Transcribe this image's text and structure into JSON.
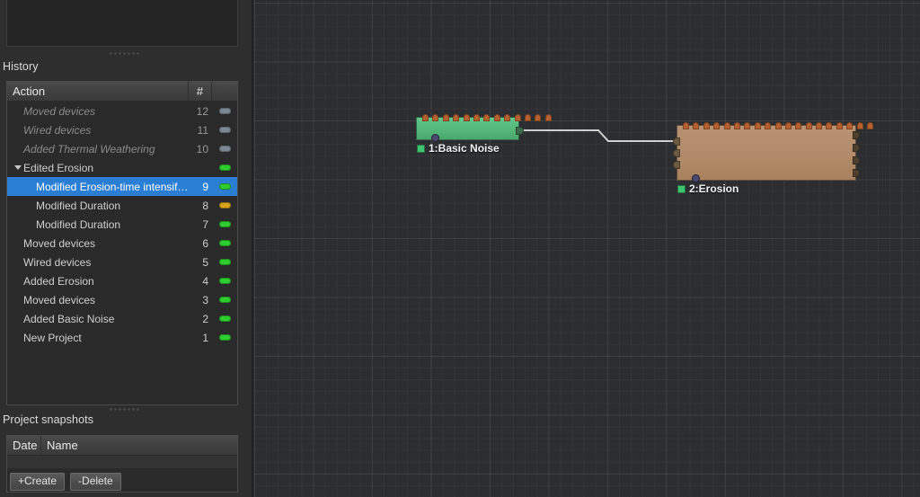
{
  "panels": {
    "history_title": "History",
    "snapshots_title": "Project snapshots"
  },
  "history": {
    "columns": {
      "action": "Action",
      "number": "#",
      "flag": ""
    },
    "rows": [
      {
        "label": "Moved devices",
        "num": "12",
        "flag": "grey",
        "indent": 1,
        "state": "undone",
        "selected": false,
        "twisty": false
      },
      {
        "label": "Wired devices",
        "num": "11",
        "flag": "grey",
        "indent": 1,
        "state": "undone",
        "selected": false,
        "twisty": false
      },
      {
        "label": "Added Thermal Weathering",
        "num": "10",
        "flag": "grey",
        "indent": 1,
        "state": "undone",
        "selected": false,
        "twisty": false
      },
      {
        "label": "Edited Erosion",
        "num": "",
        "flag": "green",
        "indent": 1,
        "state": "done",
        "selected": false,
        "twisty": true
      },
      {
        "label": "Modified Erosion-time intensifier",
        "num": "9",
        "flag": "green",
        "indent": 2,
        "state": "done",
        "selected": true,
        "twisty": false
      },
      {
        "label": "Modified Duration",
        "num": "8",
        "flag": "amber",
        "indent": 2,
        "state": "done",
        "selected": false,
        "twisty": false
      },
      {
        "label": "Modified Duration",
        "num": "7",
        "flag": "green",
        "indent": 2,
        "state": "done",
        "selected": false,
        "twisty": false
      },
      {
        "label": "Moved devices",
        "num": "6",
        "flag": "green",
        "indent": 1,
        "state": "done",
        "selected": false,
        "twisty": false
      },
      {
        "label": "Wired devices",
        "num": "5",
        "flag": "green",
        "indent": 1,
        "state": "done",
        "selected": false,
        "twisty": false
      },
      {
        "label": "Added Erosion",
        "num": "4",
        "flag": "green",
        "indent": 1,
        "state": "done",
        "selected": false,
        "twisty": false
      },
      {
        "label": "Moved devices",
        "num": "3",
        "flag": "green",
        "indent": 1,
        "state": "done",
        "selected": false,
        "twisty": false
      },
      {
        "label": "Added Basic Noise",
        "num": "2",
        "flag": "green",
        "indent": 1,
        "state": "done",
        "selected": false,
        "twisty": false
      },
      {
        "label": "New Project",
        "num": "1",
        "flag": "green",
        "indent": 1,
        "state": "done",
        "selected": false,
        "twisty": false
      }
    ]
  },
  "snapshots": {
    "columns": {
      "date": "Date",
      "name": "Name"
    },
    "rows": [],
    "create_label": "+Create",
    "delete_label": "-Delete"
  },
  "graph": {
    "nodes": [
      {
        "id": "1",
        "label": "1:Basic Noise",
        "title": "Basic Noise",
        "color": "#54b87a",
        "top_pins": 13,
        "left_pins": 0,
        "right_pins": 0
      },
      {
        "id": "2",
        "label": "2:Erosion",
        "title": "Erosion",
        "color": "#b18a68",
        "top_pins": 19,
        "left_pins": 3,
        "right_pins": 4
      }
    ],
    "wires": [
      {
        "from": "1",
        "to": "2"
      }
    ]
  },
  "colors": {
    "selection_blue": "#2a7fd4",
    "flag_green": "#2ecc2e",
    "flag_amber": "#d7a21a",
    "flag_grey": "#7b8894",
    "node_noise": "#54b87a",
    "node_erosion": "#b18a68",
    "pin_orange": "#b5602e",
    "canvas_bg": "#2b2d30"
  }
}
